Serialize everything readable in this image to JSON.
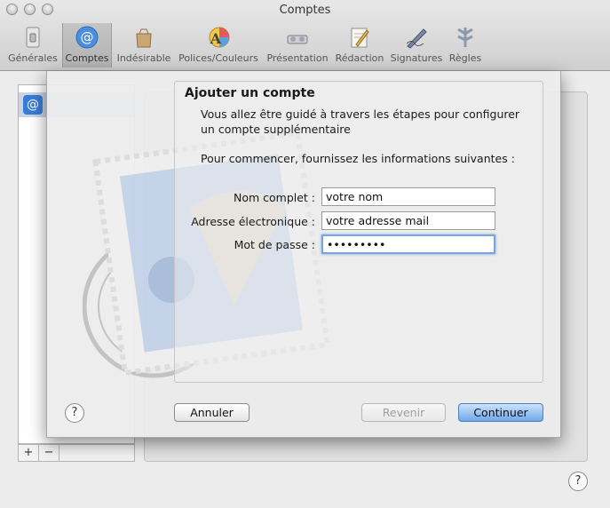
{
  "window": {
    "title": "Comptes"
  },
  "toolbar": {
    "items": [
      {
        "label": "Générales",
        "icon": "general-switch-icon"
      },
      {
        "label": "Comptes",
        "icon": "at-sign-icon"
      },
      {
        "label": "Indésirable",
        "icon": "junk-bag-icon"
      },
      {
        "label": "Polices/Couleurs",
        "icon": "fonts-colors-icon"
      },
      {
        "label": "Présentation",
        "icon": "viewing-glasses-icon"
      },
      {
        "label": "Rédaction",
        "icon": "composing-pencil-icon"
      },
      {
        "label": "Signatures",
        "icon": "signature-pen-icon"
      },
      {
        "label": "Règles",
        "icon": "rules-icon"
      }
    ],
    "selected_index": 1
  },
  "accounts": {
    "add_label": "+",
    "remove_label": "−",
    "row_icon": "@"
  },
  "help": {
    "label": "?"
  },
  "sheet": {
    "title": "Ajouter un compte",
    "intro": "Vous allez être guidé à travers les étapes pour configurer un compte supplémentaire",
    "instruction": "Pour commencer, fournissez les informations suivantes :",
    "fields": {
      "name": {
        "label": "Nom complet :",
        "value": "votre nom"
      },
      "email": {
        "label": "Adresse électronique :",
        "value": "votre adresse mail"
      },
      "password": {
        "label": "Mot de passe :",
        "value": "•••••••••"
      }
    },
    "buttons": {
      "cancel": "Annuler",
      "back": "Revenir",
      "continue": "Continuer"
    }
  },
  "colors": {
    "accent": "#6fa7ea",
    "selection": "#c9d4e6",
    "account_icon": "#3a7bd5"
  }
}
